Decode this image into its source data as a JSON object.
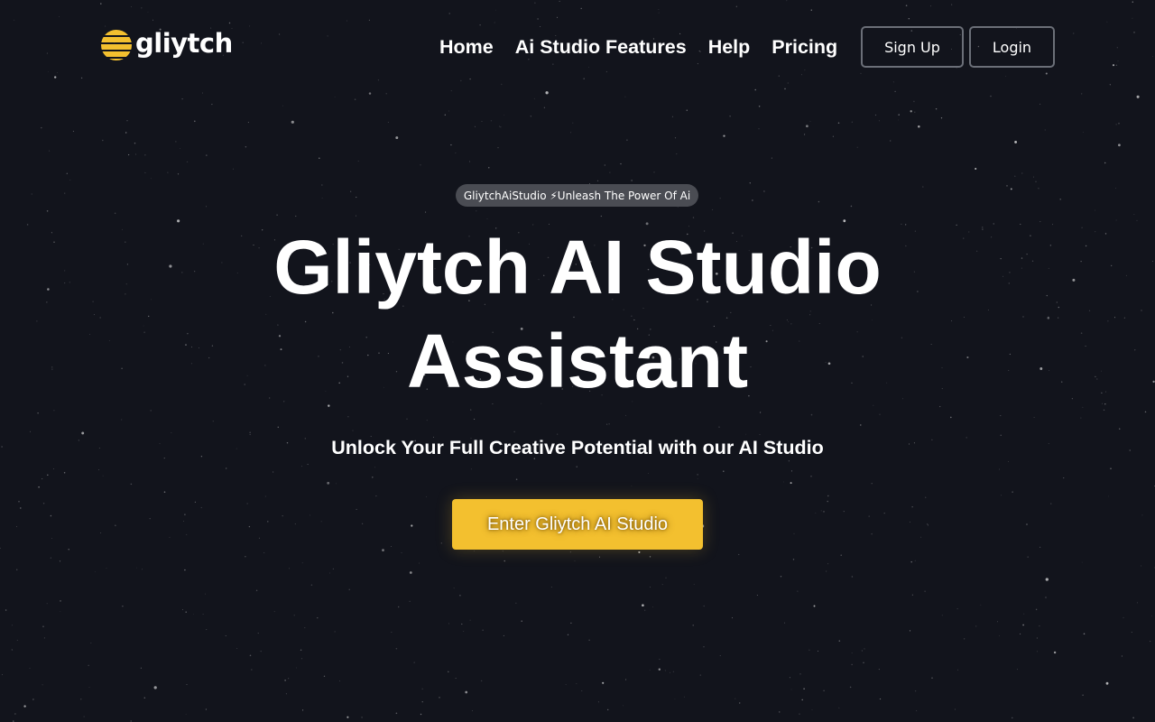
{
  "brand": {
    "name": "gliytch",
    "logo_icon": "striped-sphere-icon",
    "accent_color": "#f3c02f"
  },
  "nav": {
    "links": [
      "Home",
      "Ai Studio Features",
      "Help",
      "Pricing"
    ],
    "signup_label": "Sign Up",
    "login_label": "Login"
  },
  "hero": {
    "badge": "GliytchAiStudio ⚡Unleash The Power Of Ai",
    "title_line1": "Gliytch AI Studio",
    "title_line2": "Assistant",
    "subtitle": "Unlock Your Full Creative Potential with our AI Studio",
    "cta_label": "Enter Gliytch AI Studio"
  },
  "colors": {
    "background": "#12141c",
    "button_border": "#6b6f78",
    "badge_bg": "#4a4c53"
  }
}
